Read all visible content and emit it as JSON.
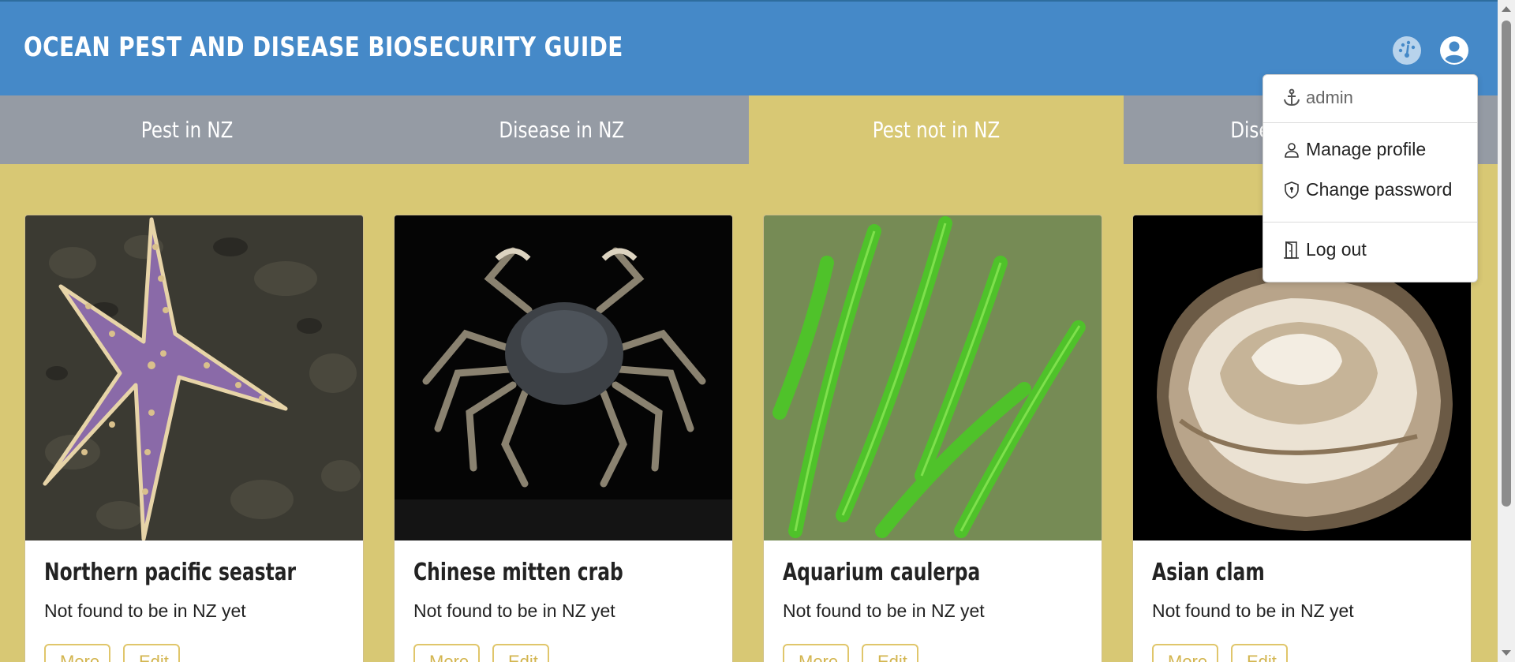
{
  "header": {
    "title": "OCEAN PEST AND DISEASE BIOSECURITY GUIDE",
    "icons": [
      "dashboard-icon",
      "user-circle-icon"
    ]
  },
  "tabs": [
    {
      "label": "Pest in NZ",
      "active": false
    },
    {
      "label": "Disease in NZ",
      "active": false
    },
    {
      "label": "Pest not in NZ",
      "active": true
    },
    {
      "label": "Disease not in NZ",
      "active": false
    }
  ],
  "cards": [
    {
      "title": "Northern pacific seastar",
      "status": "Not found to be in NZ yet",
      "more_label": "More",
      "edit_label": "Edit"
    },
    {
      "title": "Chinese mitten crab",
      "status": "Not found to be in NZ yet",
      "more_label": "More",
      "edit_label": "Edit"
    },
    {
      "title": "Aquarium caulerpa",
      "status": "Not found to be in NZ yet",
      "more_label": "More",
      "edit_label": "Edit"
    },
    {
      "title": "Asian clam",
      "status": "Not found to be in NZ yet",
      "more_label": "More",
      "edit_label": "Edit"
    }
  ],
  "user_menu": {
    "username": "admin",
    "items": [
      {
        "label": "Manage profile",
        "icon": "person-icon"
      },
      {
        "label": "Change password",
        "icon": "shield-icon"
      },
      {
        "label": "Log out",
        "icon": "door-icon"
      }
    ]
  },
  "colors": {
    "header_bg": "#4589c8",
    "tab_bg": "#959ba4",
    "active_tab_bg": "#d8c874",
    "page_bg": "#d8c874",
    "button_accent": "#d3b54f"
  }
}
